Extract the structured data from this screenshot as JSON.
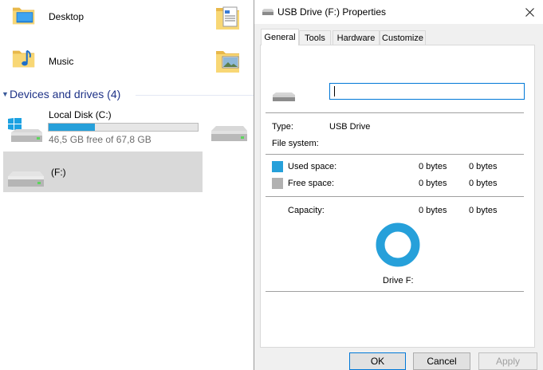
{
  "explorer": {
    "folders": [
      {
        "label": "Desktop",
        "icon": "desktop-folder-icon"
      },
      {
        "label": "Music",
        "icon": "music-folder-icon"
      }
    ],
    "section_title": "Devices and drives (4)",
    "local_disk": {
      "name": "Local Disk (C:)",
      "free_text": "46,5 GB free of 67,8 GB",
      "used_fraction": 0.31
    },
    "f_drive": {
      "name": "(F:)"
    }
  },
  "dialog": {
    "title": "USB Drive (F:) Properties",
    "tabs": [
      "General",
      "Tools",
      "Hardware",
      "Customize"
    ],
    "name_value": "",
    "type_label": "Type:",
    "type_value": "USB Drive",
    "fs_label": "File system:",
    "fs_value": "",
    "used_label": "Used space:",
    "used_bytes": "0 bytes",
    "used_size": "0 bytes",
    "free_label": "Free space:",
    "free_bytes": "0 bytes",
    "free_size": "0 bytes",
    "capacity_label": "Capacity:",
    "capacity_bytes": "0 bytes",
    "capacity_size": "0 bytes",
    "drive_label": "Drive F:",
    "buttons": {
      "ok": "OK",
      "cancel": "Cancel",
      "apply": "Apply"
    },
    "colors": {
      "used": "#26a0da",
      "free": "#b1b1b1",
      "accent": "#0078d7"
    }
  }
}
